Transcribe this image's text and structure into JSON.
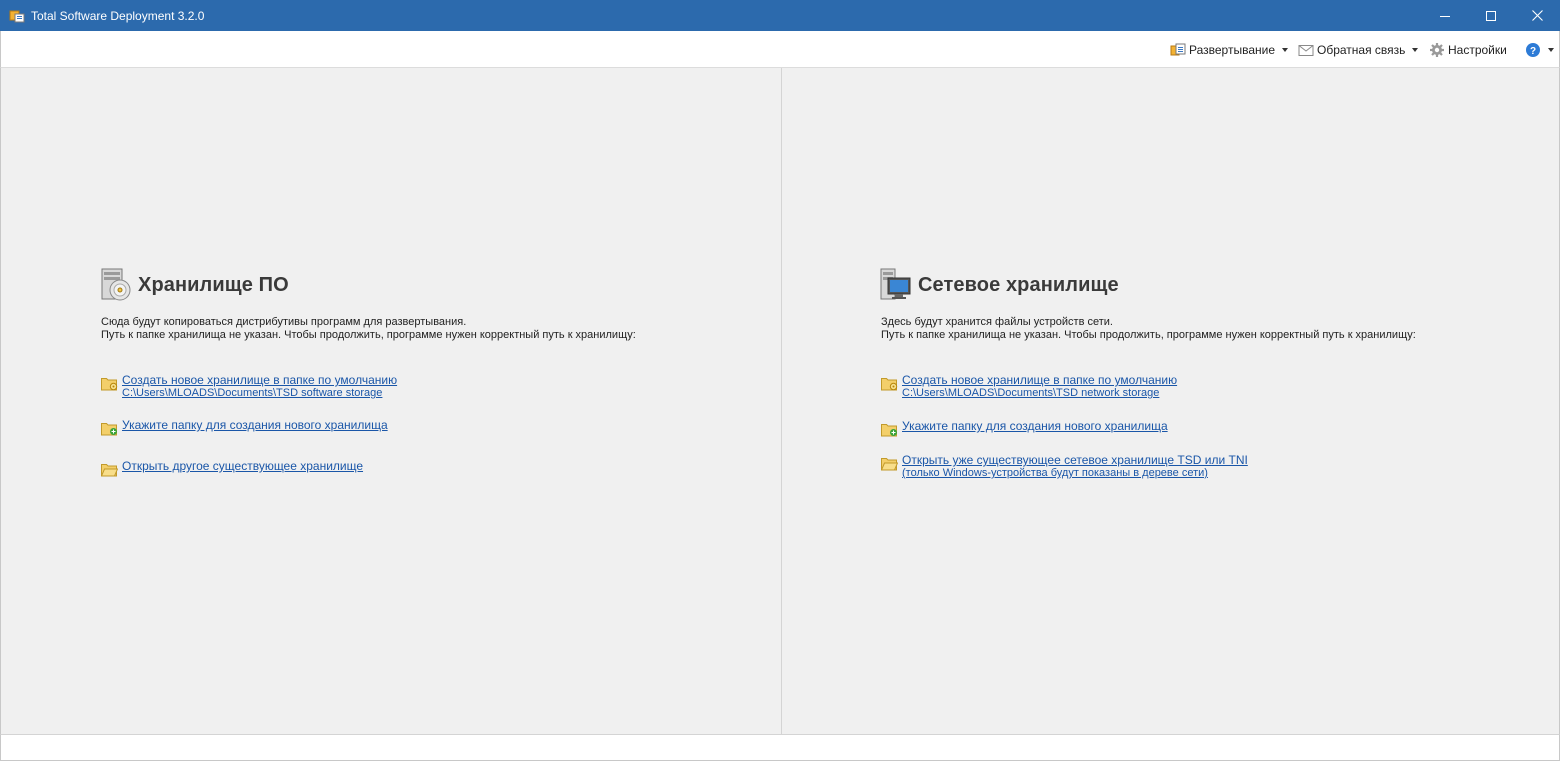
{
  "window": {
    "title": "Total Software Deployment 3.2.0",
    "controls": {
      "minimize": "minimize-icon",
      "maximize": "maximize-icon",
      "close": "close-icon"
    }
  },
  "toolbar": {
    "deploy_label": "Развертывание",
    "feedback_label": "Обратная связь",
    "settings_label": "Настройки",
    "help_icon": "help-icon"
  },
  "colors": {
    "titlebar": "#2c6aad",
    "link": "#1a56a8",
    "panel_bg": "#f0f0f0"
  },
  "software_storage": {
    "title": "Хранилище ПО",
    "desc_line1": "Сюда будут копироваться дистрибутивы программ для развертывания.",
    "desc_line2": "Путь к папке хранилища не указан. Чтобы продолжить, программе нужен корректный путь к хранилищу:",
    "link_create": "Создать новое хранилище в папке по умолчанию",
    "link_create_path": "C:\\Users\\MLOADS\\Documents\\TSD software storage",
    "link_choose": "Укажите папку для создания нового хранилища",
    "link_open": "Открыть другое существующее хранилище"
  },
  "network_storage": {
    "title": "Сетевое хранилище",
    "desc_line1": "Здесь будут хранится файлы устройств сети.",
    "desc_line2": "Путь к папке хранилища не указан. Чтобы продолжить, программе нужен корректный путь к хранилищу:",
    "link_create": "Создать новое хранилище в папке по умолчанию",
    "link_create_path": "C:\\Users\\MLOADS\\Documents\\TSD network storage",
    "link_choose": "Укажите папку для создания нового хранилища",
    "link_open": "Открыть уже существующее сетевое хранилище TSD или TNI",
    "link_open_note": "(только Windows-устройства будут показаны в дереве сети)"
  }
}
